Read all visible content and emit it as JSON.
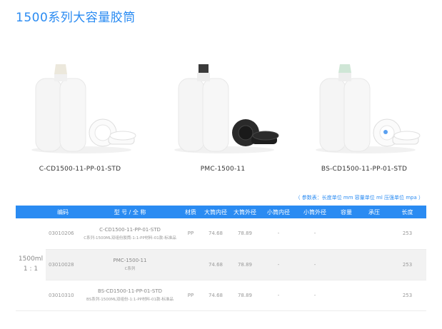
{
  "page": {
    "title": "1500系列大容量胶筒"
  },
  "products": [
    {
      "label": "C-CD1500-11-PP-01-STD",
      "cap_color": "#ece8dc",
      "piston_color": "#ffffff"
    },
    {
      "label": "PMC-1500-11",
      "cap_color": "#3a3a3a",
      "piston_color": "#1e1e1e"
    },
    {
      "label": "BS-CD1500-11-PP-01-STD",
      "cap_color": "#cfe6d6",
      "piston_color": "#ffffff"
    }
  ],
  "units_note": "（ 参数表：长度单位 mm   容量单位 ml   压强单位 mpa ）",
  "table": {
    "headers": [
      "",
      "编码",
      "型 号 / 全 称",
      "材质",
      "大筒内径",
      "大筒外径",
      "小筒内径",
      "小筒外径",
      "容量",
      "承压",
      "长度"
    ],
    "group_label_1": "1500ml",
    "group_label_2": "1 : 1",
    "rows": [
      {
        "code": "03010206",
        "model": "C-CD1500-11-PP-01-STD",
        "desc": "C系列-1500ML双组份胶筒-1:1-PP材料-01款-标准品",
        "material": "PP",
        "big_inner": "74.68",
        "big_outer": "78.89",
        "small_inner": "-",
        "small_outer": "-",
        "capacity": "",
        "pressure": "",
        "length": "253"
      },
      {
        "code": "03010028",
        "model": "PMC-1500-11",
        "desc": "C系列",
        "material": "",
        "big_inner": "74.68",
        "big_outer": "78.89",
        "small_inner": "-",
        "small_outer": "-",
        "capacity": "",
        "pressure": "",
        "length": "253"
      },
      {
        "code": "03010310",
        "model": "BS-CD1500-11-PP-01-STD",
        "desc": "BS系列-1500ML双组份-1:1-PP材料-01款-标准品",
        "material": "PP",
        "big_inner": "74.68",
        "big_outer": "78.89",
        "small_inner": "-",
        "small_outer": "-",
        "capacity": "",
        "pressure": "",
        "length": "253"
      }
    ]
  },
  "colors": {
    "accent": "#2a8bf2",
    "row_shade": "#f2f2f2"
  }
}
